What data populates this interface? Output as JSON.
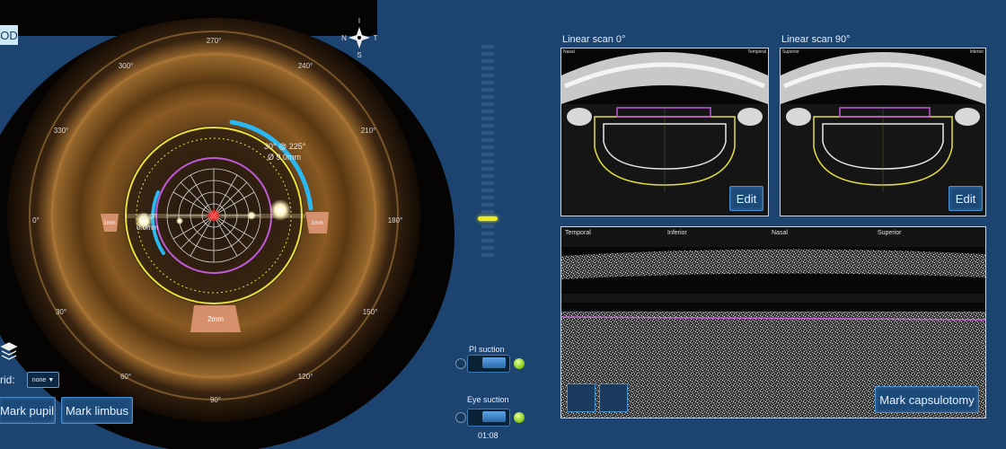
{
  "eye_badge": "OD",
  "compass": {
    "top": "I",
    "left": "N",
    "right": "T",
    "bottom": "S"
  },
  "angles": {
    "a270": "270°",
    "a240": "240°",
    "a300": "300°",
    "a330": "330°",
    "a210": "210°",
    "a0": "0°",
    "a180": "180°",
    "a30": "30°",
    "a150": "150°",
    "a60": "60°",
    "a120": "120°",
    "a90": "90°"
  },
  "overlay": {
    "axis_readout": "30° @ 225°",
    "diameter_readout": "Ø 9.0mm",
    "left_readout_1": "@ 0°",
    "left_readout_2": "0.0mm",
    "marker_left": "1mm",
    "marker_right": "1mm",
    "marker_bottom": "2mm"
  },
  "grid": {
    "label": "rid:",
    "value": "none"
  },
  "buttons": {
    "mark_pupil": "Mark pupil",
    "mark_limbus": "Mark limbus",
    "edit_0": "Edit",
    "edit_90": "Edit",
    "mark_capsulotomy": "Mark capsulotomy"
  },
  "suction": {
    "pi_label": "PI suction",
    "eye_label": "Eye suction",
    "timer": "01:08"
  },
  "scans": {
    "linear_0": {
      "title": "Linear scan 0°",
      "left_label": "Nasal",
      "right_label": "Temporal"
    },
    "linear_90": {
      "title": "Linear scan 90°",
      "left_label": "Superior",
      "right_label": "Inferior"
    },
    "circular": {
      "labels": [
        "Temporal",
        "Inferior",
        "Nasal",
        "Superior"
      ]
    }
  },
  "colors": {
    "background": "#1d4470",
    "overlay_yellow": "#e8e23a",
    "overlay_magenta": "#c05ad8",
    "arc_cyan": "#2ab8f0",
    "level_indicator": "#f0ea1e"
  }
}
